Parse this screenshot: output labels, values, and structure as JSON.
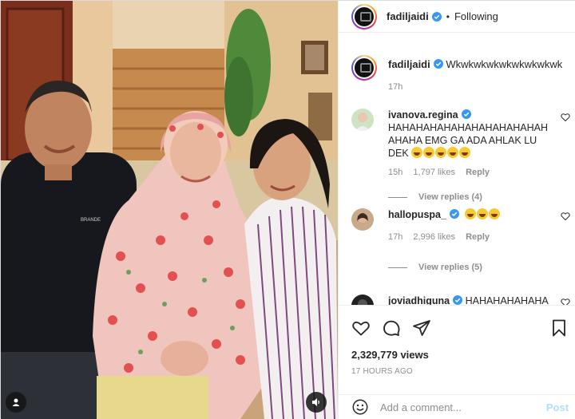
{
  "post": {
    "author": "fadiljaidi",
    "follow_state": "Following",
    "dot": "•",
    "caption": "Wkwkwkwkwkwkwkwkwk",
    "caption_time": "17h",
    "views": "2,329,779 views",
    "timestamp": "17 HOURS AGO"
  },
  "comments": [
    {
      "username": "ivanova.regina",
      "text": "HAHAHAHAHAHAHAHAHAHAHAH AHAHA EMG GA ADA AHLAK LU DEK",
      "emoji_count": 5,
      "time": "15h",
      "likes": "1,797 likes",
      "reply_label": "Reply",
      "view_replies": "View replies (4)"
    },
    {
      "username": "hallopuspa_",
      "text": "",
      "emoji_count": 3,
      "time": "17h",
      "likes": "2,996 likes",
      "reply_label": "Reply",
      "view_replies": "View replies (5)"
    },
    {
      "username": "joviadhiguna",
      "text": "HAHAHAHAHAHA"
    }
  ],
  "composer": {
    "placeholder": "Add a comment...",
    "post_label": "Post"
  },
  "icons": {
    "verified": "verified-badge-icon",
    "heart": "heart-icon",
    "comment": "comment-icon",
    "share": "share-icon",
    "bookmark": "bookmark-icon",
    "emoji": "emoji-icon",
    "tag": "user-tag-icon",
    "sound": "sound-icon"
  },
  "colors": {
    "verified": "#3897f0",
    "post_disabled": "#b2dffc",
    "muted": "#8e8e8e"
  }
}
